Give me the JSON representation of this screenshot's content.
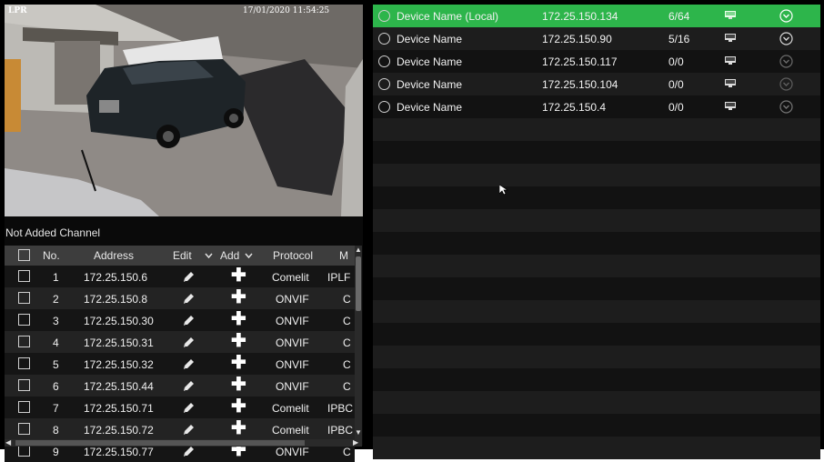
{
  "camera": {
    "label": "LPR",
    "timestamp": "17/01/2020 11:54:25"
  },
  "channels": {
    "title": "Not Added Channel",
    "headers": {
      "no": "No.",
      "address": "Address",
      "edit": "Edit",
      "add": "Add",
      "protocol": "Protocol",
      "more": "M"
    },
    "rows": [
      {
        "no": "1",
        "address": "172.25.150.6",
        "protocol": "Comelit",
        "model": "IPLF"
      },
      {
        "no": "2",
        "address": "172.25.150.8",
        "protocol": "ONVIF",
        "model": "C"
      },
      {
        "no": "3",
        "address": "172.25.150.30",
        "protocol": "ONVIF",
        "model": "C"
      },
      {
        "no": "4",
        "address": "172.25.150.31",
        "protocol": "ONVIF",
        "model": "C"
      },
      {
        "no": "5",
        "address": "172.25.150.32",
        "protocol": "ONVIF",
        "model": "C"
      },
      {
        "no": "6",
        "address": "172.25.150.44",
        "protocol": "ONVIF",
        "model": "C"
      },
      {
        "no": "7",
        "address": "172.25.150.71",
        "protocol": "Comelit",
        "model": "IPBC"
      },
      {
        "no": "8",
        "address": "172.25.150.72",
        "protocol": "Comelit",
        "model": "IPBC"
      },
      {
        "no": "9",
        "address": "172.25.150.77",
        "protocol": "ONVIF",
        "model": "C"
      }
    ]
  },
  "devices": {
    "rows": [
      {
        "name": "Device Name (Local)",
        "ip": "172.25.150.134",
        "count": "6/64",
        "selected": true
      },
      {
        "name": "Device Name",
        "ip": "172.25.150.90",
        "count": "5/16",
        "selected": false
      },
      {
        "name": "Device Name",
        "ip": "172.25.150.117",
        "count": "0/0",
        "selected": false
      },
      {
        "name": "Device Name",
        "ip": "172.25.150.104",
        "count": "0/0",
        "selected": false
      },
      {
        "name": "Device Name",
        "ip": "172.25.150.4",
        "count": "0/0",
        "selected": false
      }
    ]
  },
  "icons": {
    "edit": "pencil-icon",
    "add": "plus-icon",
    "monitor": "monitor-icon",
    "expand": "chevron-down-circle-icon",
    "sort": "chevron-down-icon"
  },
  "colors": {
    "selected_row": "#2db54b"
  }
}
